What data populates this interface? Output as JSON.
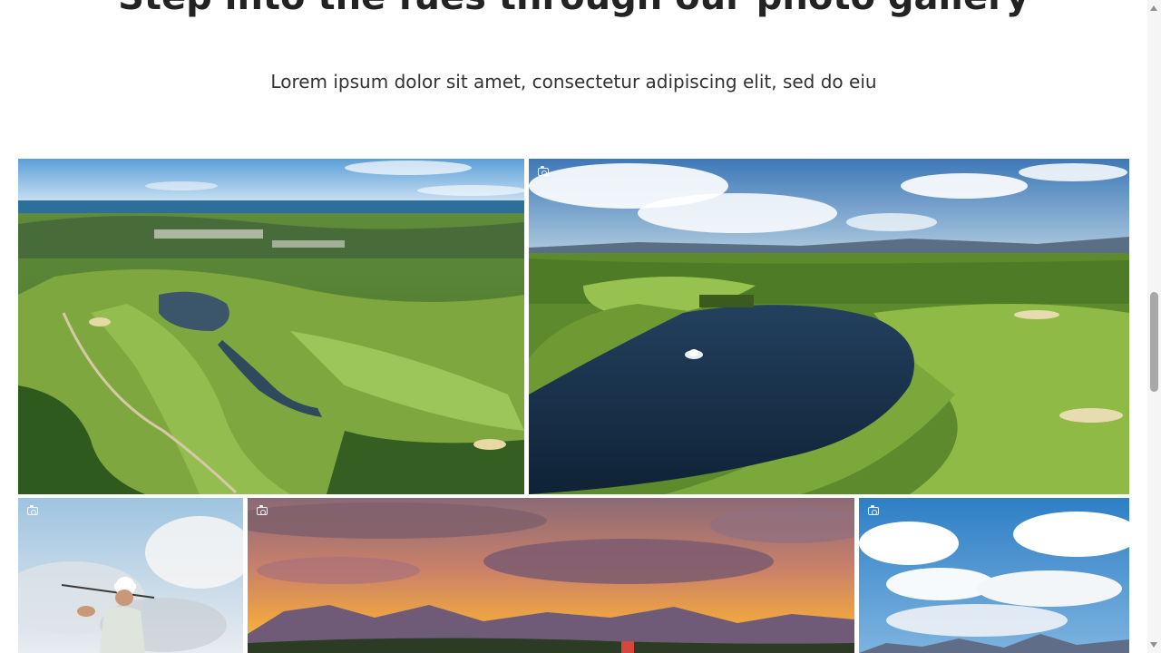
{
  "section": {
    "title": "Step into the fues through our photo gallery",
    "subtitle": "Lorem ipsum dolor sit amet, consectetur adipiscing elit, sed do eiu"
  },
  "gallery": {
    "photo_icon": "camera-icon",
    "photos": [
      {
        "subject": "aerial golf course with sea"
      },
      {
        "subject": "golf course lake with fountain"
      },
      {
        "subject": "golfer swinging"
      },
      {
        "subject": "sunset over mountains"
      },
      {
        "subject": "clouds over mountains"
      }
    ]
  },
  "colors": {
    "heading": "#232323",
    "text": "#333333",
    "background": "#ffffff"
  }
}
